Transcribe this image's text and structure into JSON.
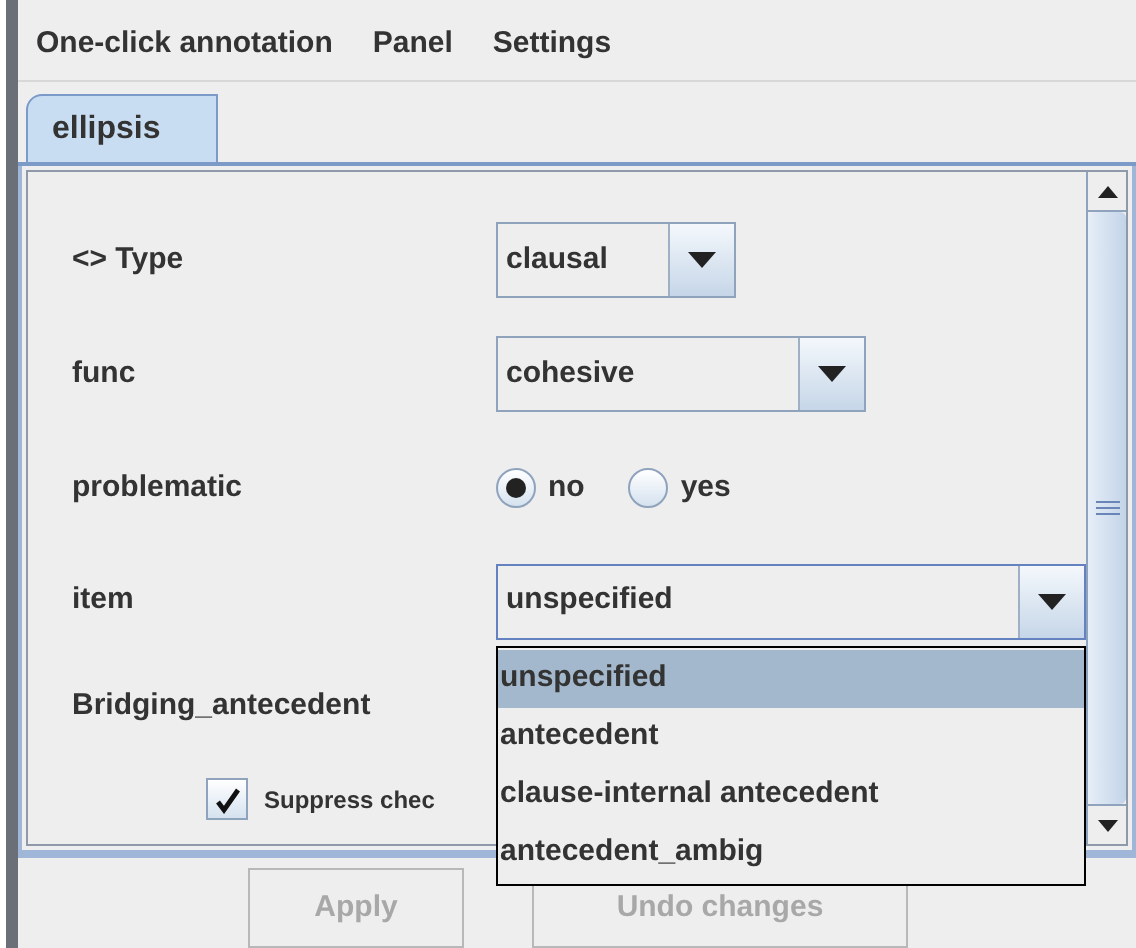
{
  "menu": [
    "One-click annotation",
    "Panel",
    "Settings"
  ],
  "tabs": [
    {
      "label": "ellipsis",
      "selected": true
    }
  ],
  "fields": [
    {
      "kind": "dropdown",
      "label": "<> Type",
      "value": "clausal",
      "expanded": false
    },
    {
      "kind": "dropdown",
      "label": "func",
      "value": "cohesive",
      "expanded": false
    },
    {
      "kind": "radio",
      "label": "problematic",
      "options": [
        {
          "label": "no",
          "selected": true
        },
        {
          "label": "yes",
          "selected": false
        }
      ]
    },
    {
      "kind": "dropdown",
      "label": "item",
      "value": "unspecified",
      "expanded": true,
      "options": [
        {
          "label": "unspecified",
          "selected": true
        },
        {
          "label": "antecedent",
          "selected": false
        },
        {
          "label": "clause-internal antecedent",
          "selected": false
        },
        {
          "label": "antecedent_ambig",
          "selected": false
        }
      ]
    },
    {
      "kind": "label",
      "label": "Bridging_antecedent"
    },
    {
      "kind": "checkbox",
      "label": "Suppress chec",
      "checked": true
    }
  ],
  "buttons": [
    {
      "label": "Apply",
      "disabled": true
    },
    {
      "label": "Undo changes",
      "disabled": true
    }
  ]
}
